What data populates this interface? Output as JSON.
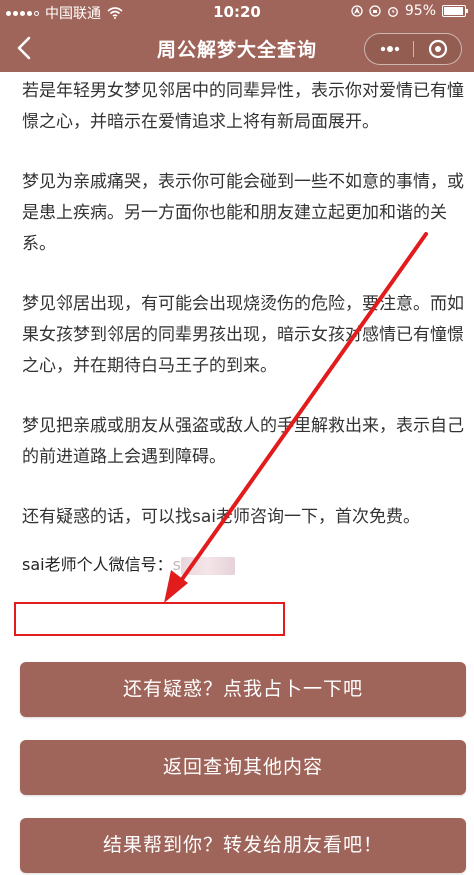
{
  "status_bar": {
    "carrier": "中国联通",
    "time": "10:20",
    "battery": "95%",
    "battery_level": 0.95
  },
  "nav": {
    "title": "周公解梦大全查询"
  },
  "content": {
    "paragraphs": [
      "若是年轻男女梦见邻居中的同辈异性，表示你对爱情已有憧憬之心，并暗示在爱情追求上将有新局面展开。",
      "梦见为亲戚痛哭，表示你可能会碰到一些不如意的事情，或是患上疾病。另一方面你也能和朋友建立起更加和谐的关系。",
      "梦见邻居出现，有可能会出现烧烫伤的危险，要注意。而如果女孩梦到邻居的同辈男孩出现，暗示女孩对感情已有憧憬之心，并在期待白马王子的到来。",
      "梦见把亲戚或朋友从强盗或敌人的手里解救出来，表示自己的前进道路上会遇到障碍。",
      "还有疑惑的话，可以找sai老师咨询一下，首次免费。"
    ],
    "wechat_label": "sai老师个人微信号：",
    "wechat_value_prefix": "s"
  },
  "buttons": {
    "divine": "还有疑惑？点我占卜一下吧",
    "back_query": "返回查询其他内容",
    "share": "结果帮到你？转发给朋友看吧！"
  },
  "colors": {
    "brand": "#a0655a",
    "annotation_red": "#e21c1c"
  }
}
